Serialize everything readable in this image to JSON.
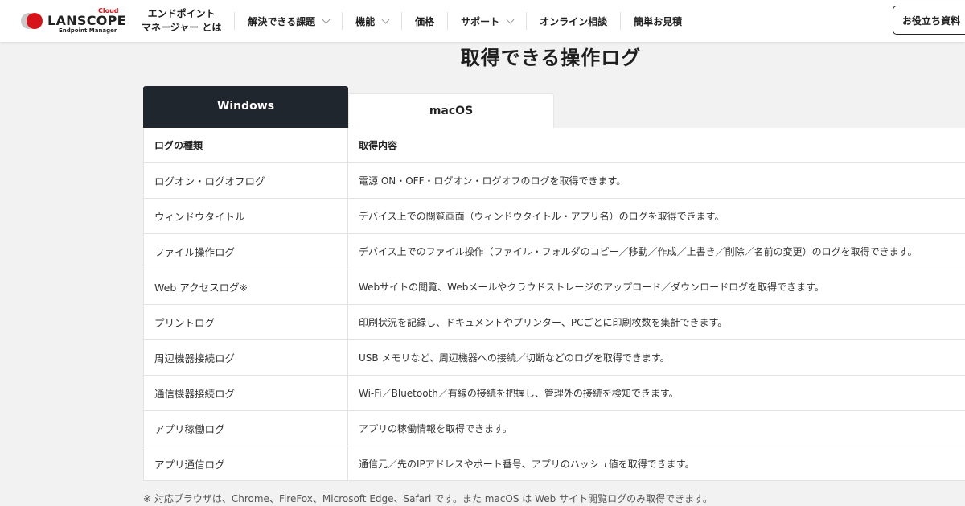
{
  "header": {
    "logo": {
      "cloud": "Cloud",
      "main": "LANSCOPE",
      "sub": "Endpoint Manager"
    },
    "nav": [
      {
        "line1": "エンドポイント",
        "line2": "マネージャー とは"
      },
      {
        "label": "解決できる課題",
        "has_dropdown": true
      },
      {
        "label": "機能",
        "has_dropdown": true
      },
      {
        "label": "価格",
        "has_dropdown": false
      },
      {
        "label": "サポート",
        "has_dropdown": true
      },
      {
        "label": "オンライン相談",
        "has_dropdown": false
      },
      {
        "label": "簡単お見積",
        "has_dropdown": false
      }
    ],
    "cta_label": "お役立ち資料"
  },
  "main": {
    "title": "取得できる操作ログ",
    "tabs": [
      {
        "label": "Windows",
        "active": true
      },
      {
        "label": "macOS",
        "active": false
      }
    ],
    "table": {
      "headers": [
        "ログの種類",
        "取得内容"
      ],
      "rows": [
        [
          "ログオン・ログオフログ",
          "電源 ON・OFF・ログオン・ログオフのログを取得できます。"
        ],
        [
          "ウィンドウタイトル",
          "デバイス上での閲覧画面（ウィンドウタイトル・アプリ名）のログを取得できます。"
        ],
        [
          "ファイル操作ログ",
          "デバイス上でのファイル操作（ファイル・フォルダのコピー／移動／作成／上書き／削除／名前の変更）のログを取得できます。"
        ],
        [
          "Web アクセスログ※",
          "Webサイトの閲覧、Webメールやクラウドストレージのアップロード／ダウンロードログを取得できます。"
        ],
        [
          "プリントログ",
          "印刷状況を記録し、ドキュメントやプリンター、PCごとに印刷枚数を集計できます。"
        ],
        [
          "周辺機器接続ログ",
          "USB メモリなど、周辺機器への接続／切断などのログを取得できます。"
        ],
        [
          "通信機器接続ログ",
          "Wi-Fi／Bluetooth／有線の接続を把握し、管理外の接続を検知できます。"
        ],
        [
          "アプリ稼働ログ",
          "アプリの稼働情報を取得できます。"
        ],
        [
          "アプリ通信ログ",
          "通信元／先のIPアドレスやポート番号、アプリのハッシュ値を取得できます。"
        ]
      ]
    },
    "note": "※ 対応ブラウザは、Chrome、FireFox、Microsoft Edge、Safari です。また macOS は Web サイト閲覧ログのみ取得できます。"
  },
  "colors": {
    "accent_red": "#d61318",
    "tab_active_bg": "#20262d",
    "page_bg": "#f2f2f2"
  }
}
